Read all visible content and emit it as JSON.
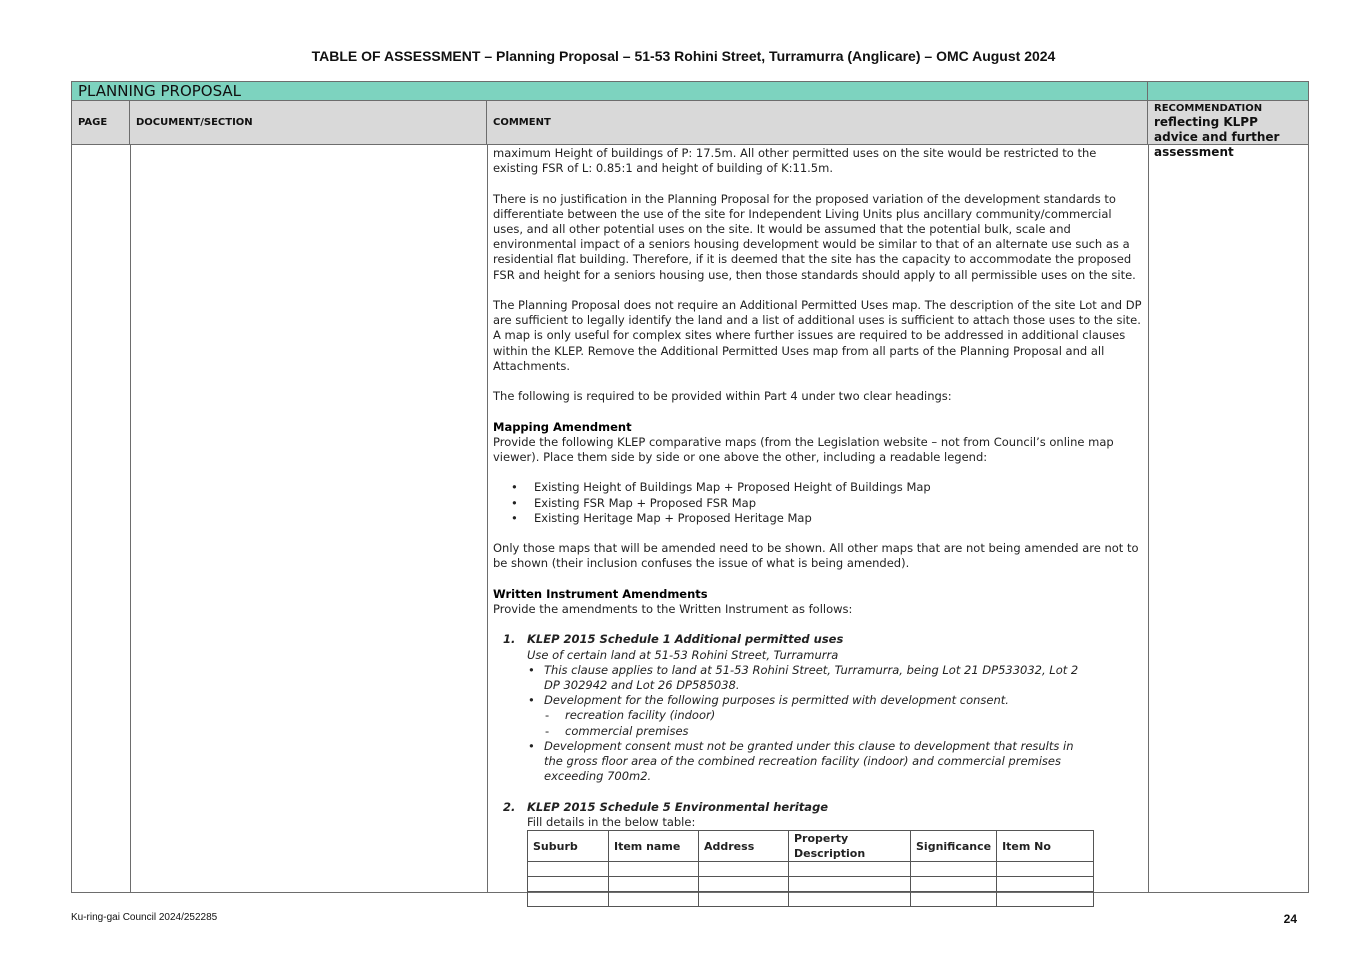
{
  "document": {
    "title": "TABLE OF ASSESSMENT – Planning Proposal – 51-53 Rohini Street, Turramurra (Anglicare) – OMC August 2024"
  },
  "section": {
    "title": "PLANNING PROPOSAL"
  },
  "columns": {
    "page": "PAGE",
    "document_section": "DOCUMENT/SECTION",
    "comment": "COMMENT",
    "recommendation_l1": "RECOMMENDATION",
    "recommendation_l2": "reflecting KLPP advice and further assessment"
  },
  "comment": {
    "p1": "maximum Height of buildings of P: 17.5m. All other permitted uses on the site would be restricted to the existing FSR of L: 0.85:1 and height of building of K:11.5m.",
    "p2": "There is no justification in the Planning Proposal for the proposed variation of the development standards to differentiate between the use of the site for Independent Living Units plus ancillary community/commercial uses, and all other potential uses on the site. It would be assumed that the potential bulk, scale and environmental impact of a seniors housing development would be similar to that of an alternate use such as a residential flat building. Therefore, if it is deemed that the site has the capacity to accommodate the proposed FSR and height for a seniors housing use, then those standards should apply to all permissible uses on the site.",
    "p3": "The Planning Proposal does not require an Additional Permitted Uses map. The description of the site Lot and DP are sufficient to legally identify the land and a list of additional uses is sufficient to attach those uses to the site. A map is only useful for complex sites where further issues are required to be addressed in additional clauses within the KLEP. Remove the Additional Permitted Uses map from all parts of the Planning Proposal and all Attachments.",
    "p4": "The following is required to be provided within Part 4 under two clear headings:",
    "mapping_heading": "Mapping Amendment",
    "mapping_text": "Provide the following KLEP comparative maps (from the Legislation website – not from Council’s online map viewer). Place them side by side or one above the other, including a readable legend:",
    "maps": [
      "Existing Height of Buildings Map + Proposed Height of Buildings Map",
      "Existing FSR Map + Proposed FSR Map",
      "Existing Heritage Map + Proposed Heritage Map"
    ],
    "p5": "Only those maps that will be amended need to be shown. All other maps that are not being amended are not to be shown (their inclusion confuses the issue of what is being amended).",
    "written_heading": "Written Instrument Amendments",
    "written_text": "Provide the amendments to the Written Instrument as follows:",
    "item1_num": "1.",
    "item1_title": "KLEP 2015 Schedule 1 Additional permitted uses",
    "item1_sub": "Use of certain land at 51-53 Rohini Street, Turramurra",
    "item1_b1": "This clause applies to land at 51-53 Rohini Street, Turramurra, being Lot 21 DP533032, Lot 2 DP 302942 and Lot 26 DP585038.",
    "item1_b2": "Development for the following purposes is permitted with development consent.",
    "item1_d1": "recreation facility (indoor)",
    "item1_d2": "commercial premises",
    "item1_b3": "Development consent must not be granted under this clause to development that results in the gross floor area of the combined recreation facility (indoor) and  commercial premises exceeding 700m2.",
    "item2_num": "2.",
    "item2_title": "KLEP 2015  Schedule 5 Environmental heritage",
    "item2_text": "Fill details in the below table:",
    "table_headers": [
      "Suburb",
      "Item name",
      "Address",
      "Property Description",
      "Significance",
      "Item No"
    ]
  },
  "footer": {
    "left": "Ku-ring-gai Council 2024/252285",
    "page_number": "24"
  }
}
